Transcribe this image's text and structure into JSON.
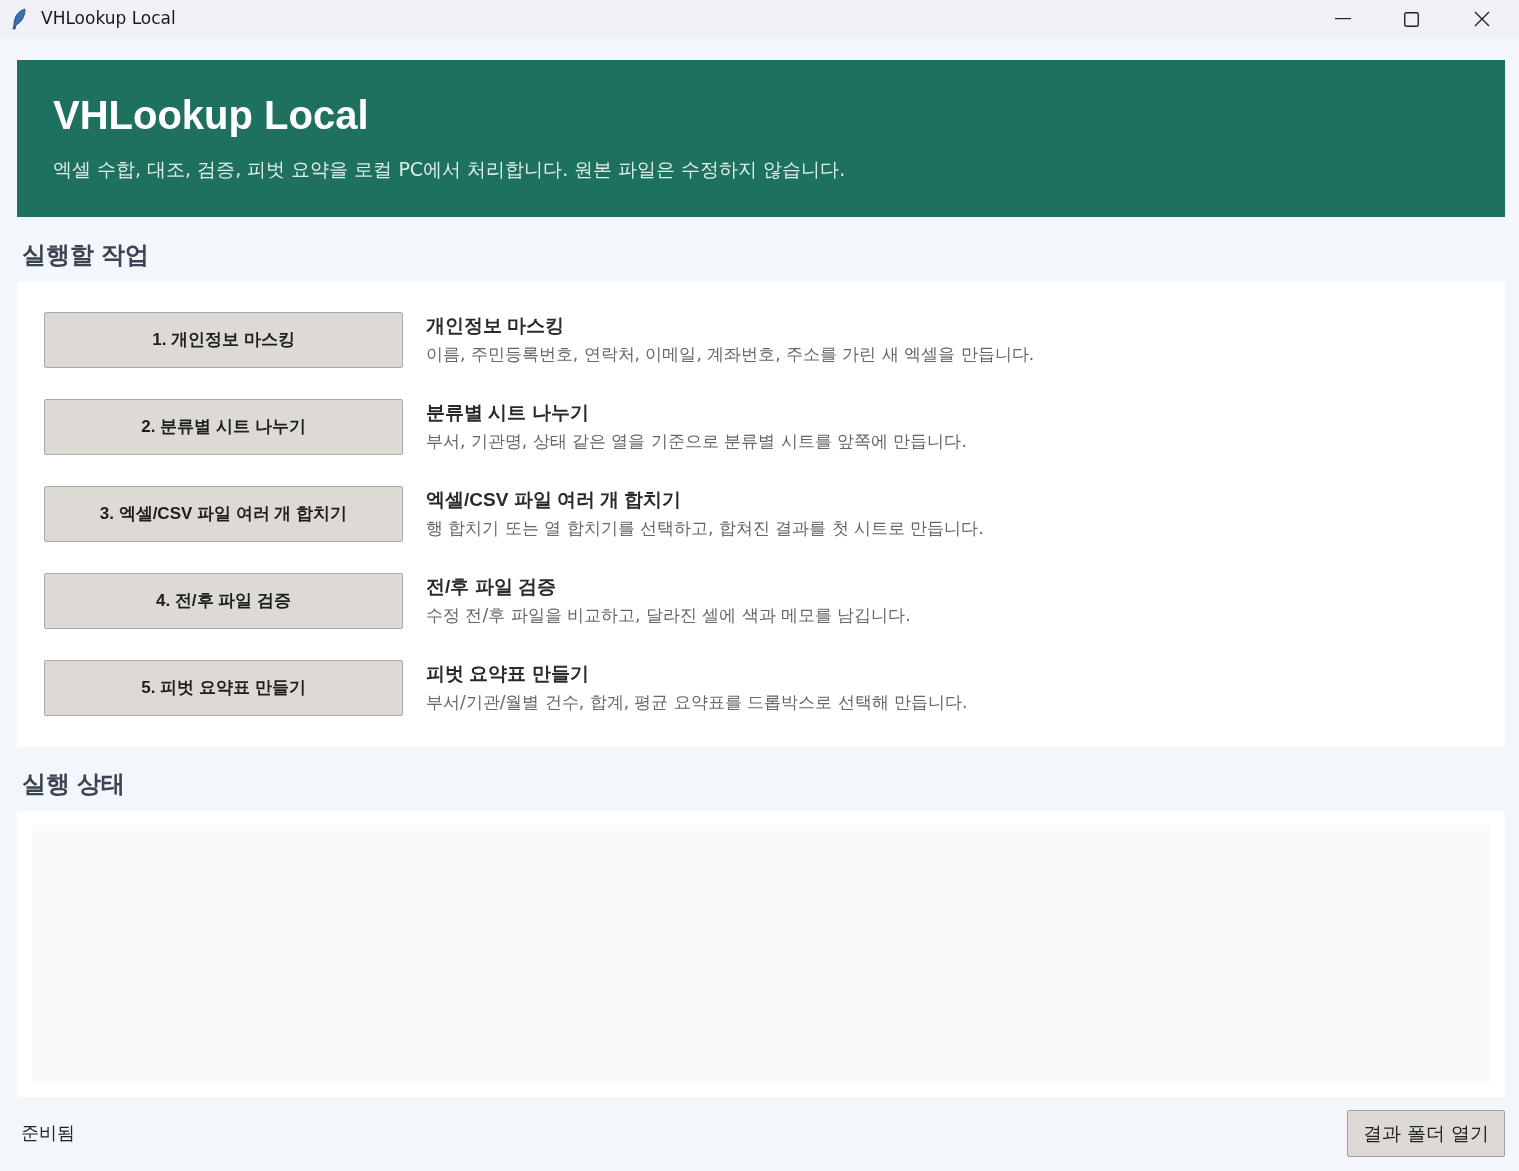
{
  "window": {
    "title": "VHLookup Local"
  },
  "header": {
    "title": "VHLookup Local",
    "subtitle": "엑셀 수합, 대조, 검증, 피벗 요약을 로컬 PC에서 처리합니다. 원본 파일은 수정하지 않습니다."
  },
  "tasks_section": {
    "heading": "실행할 작업",
    "tasks": [
      {
        "button": "1. 개인정보 마스킹",
        "title": "개인정보 마스킹",
        "description": "이름, 주민등록번호, 연락처, 이메일, 계좌번호, 주소를 가린 새 엑셀을 만듭니다."
      },
      {
        "button": "2. 분류별 시트 나누기",
        "title": "분류별 시트 나누기",
        "description": "부서, 기관명, 상태 같은 열을 기준으로 분류별 시트를 앞쪽에 만듭니다."
      },
      {
        "button": "3. 엑셀/CSV 파일 여러 개 합치기",
        "title": "엑셀/CSV 파일 여러 개 합치기",
        "description": "행 합치기 또는 열 합치기를 선택하고, 합쳐진 결과를 첫 시트로 만듭니다."
      },
      {
        "button": "4. 전/후 파일 검증",
        "title": "전/후 파일 검증",
        "description": "수정 전/후 파일을 비교하고, 달라진 셀에 색과 메모를 남깁니다."
      },
      {
        "button": "5. 피벗 요약표 만들기",
        "title": "피벗 요약표 만들기",
        "description": "부서/기관/월별 건수, 합계, 평균 요약표를 드롭박스로 선택해 만듭니다."
      }
    ]
  },
  "status_section": {
    "heading": "실행 상태"
  },
  "footer": {
    "status": "준비됨",
    "button": "결과 폴더 열기"
  }
}
